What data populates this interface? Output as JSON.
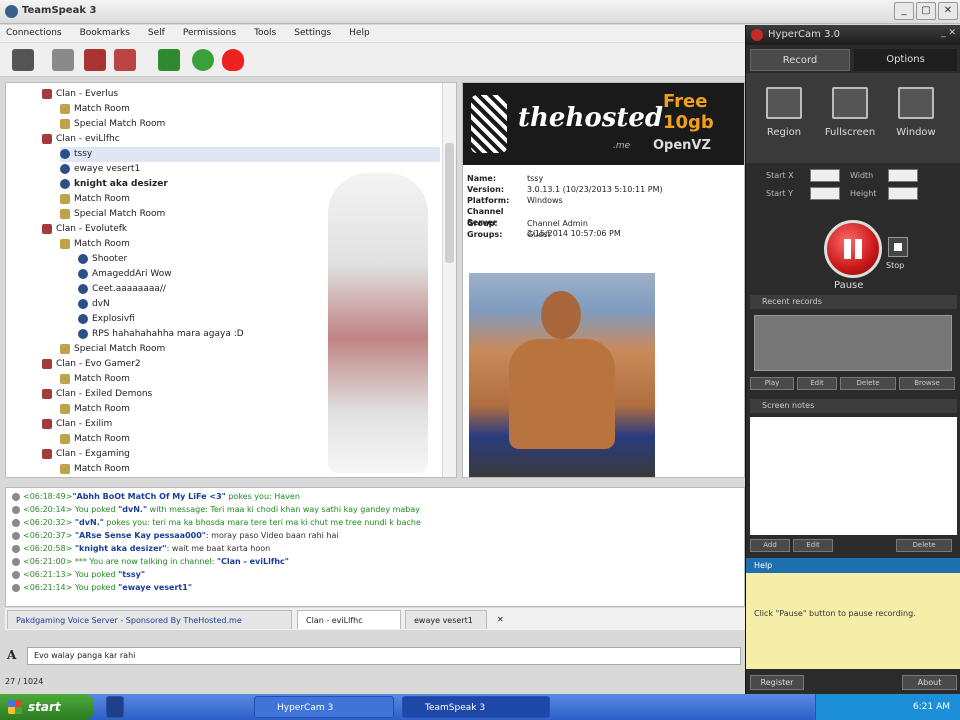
{
  "window": {
    "title": "TeamSpeak 3",
    "controls": [
      "_",
      "▢",
      "✕"
    ]
  },
  "menu": [
    "Connections",
    "Bookmarks",
    "Self",
    "Permissions",
    "Tools",
    "Settings",
    "Help"
  ],
  "tree": [
    {
      "label": "Clan - Everlus",
      "kind": "clan",
      "indent": 1
    },
    {
      "label": "Match Room",
      "kind": "chan",
      "indent": 2
    },
    {
      "label": "Special Match Room",
      "kind": "chan",
      "indent": 2
    },
    {
      "label": "Clan - eviLlfhc",
      "kind": "clan",
      "indent": 1
    },
    {
      "label": "tssy",
      "kind": "user",
      "indent": 2
    },
    {
      "label": "ewaye vesert1",
      "kind": "user",
      "indent": 2
    },
    {
      "label": "knight aka desizer",
      "kind": "user",
      "indent": 2,
      "bold": true
    },
    {
      "label": "Match Room",
      "kind": "chan",
      "indent": 2
    },
    {
      "label": "Special Match Room",
      "kind": "chan",
      "indent": 2
    },
    {
      "label": "Clan - Evolutefk",
      "kind": "clan",
      "indent": 1
    },
    {
      "label": "Match Room",
      "kind": "chan",
      "indent": 2
    },
    {
      "label": "Shooter",
      "kind": "user",
      "indent": 3
    },
    {
      "label": "AmageddAri Wow",
      "kind": "user",
      "indent": 3
    },
    {
      "label": "Ceet.aaaaaaaa//",
      "kind": "user",
      "indent": 3
    },
    {
      "label": "dvN",
      "kind": "user",
      "indent": 3
    },
    {
      "label": "Explosivfi",
      "kind": "user",
      "indent": 3
    },
    {
      "label": "RPS hahahahahha mara agaya :D",
      "kind": "user",
      "indent": 3
    },
    {
      "label": "Special Match Room",
      "kind": "chan",
      "indent": 2
    },
    {
      "label": "Clan - Evo Gamer2",
      "kind": "clan",
      "indent": 1
    },
    {
      "label": "Match Room",
      "kind": "chan",
      "indent": 2
    },
    {
      "label": "Clan - Exiled Demons",
      "kind": "clan",
      "indent": 1
    },
    {
      "label": "Match Room",
      "kind": "chan",
      "indent": 2
    },
    {
      "label": "Clan - Exilim",
      "kind": "clan",
      "indent": 1
    },
    {
      "label": "Match Room",
      "kind": "chan",
      "indent": 2
    },
    {
      "label": "Clan - Exgaming",
      "kind": "clan",
      "indent": 1
    },
    {
      "label": "Match Room",
      "kind": "chan",
      "indent": 2
    }
  ],
  "info": {
    "banner_brand": "thehosted",
    "banner_tld": ".me",
    "banner_promo": "Free 10gb",
    "banner_sub": "OpenVZ",
    "rows": [
      {
        "k": "Name:",
        "v": "tssy"
      },
      {
        "k": "Version:",
        "v": "3.0.13.1 (10/23/2013 5:10:11 PM)"
      },
      {
        "k": "Platform:",
        "v": "Windows"
      },
      {
        "k": "Channel Group:",
        "v": "Channel Admin"
      },
      {
        "k": "Server Groups:",
        "v": "Guest"
      },
      {
        "k": "",
        "v": "2/15/2014 10:57:06 PM"
      }
    ]
  },
  "chat": [
    {
      "ts": "<06:18:49>",
      "pre": "",
      "nick": "\"Abhh BoOt MatCh Of My LiFe <3\"",
      "post": " pokes you: Haven"
    },
    {
      "ts": "<06:20:14>",
      "pre": " You poked ",
      "nick": "\"dvN.\"",
      "post": " with message: Teri maa ki chodi khan way sathi kay gandey mabay"
    },
    {
      "ts": "<06:20:32>",
      "pre": " ",
      "nick": "\"dvN.\"",
      "post": " pokes you: teri ma ka bhosda mara tere teri ma ki chut me tree nundi k bache"
    },
    {
      "ts": "<06:20:37>",
      "pre": " ",
      "nick": "\"ARse Sense Kay pessaa000\"",
      "post": ": moray paso Video baan rahi hai",
      "dark": true
    },
    {
      "ts": "<06:20:58>",
      "pre": " ",
      "nick": "\"knight aka desizer\"",
      "post": ": wait me baat karta hoon",
      "dark": true
    },
    {
      "ts": "<06:21:00>",
      "pre": " *** You are now talking in channel: ",
      "nick": "\"Clan - eviLlfhc\"",
      "post": ""
    },
    {
      "ts": "<06:21:13>",
      "pre": " You poked ",
      "nick": "\"tssy\"",
      "post": ""
    },
    {
      "ts": "<06:21:14>",
      "pre": " You poked ",
      "nick": "\"ewaye vesert1\"",
      "post": ""
    }
  ],
  "tabs": [
    "Pakdgaming Voice Server - Sponsored By TheHosted.me",
    "Clan - eviLlfhc",
    "ewaye vesert1",
    "✕"
  ],
  "input": {
    "value": "Evo walay panga kar rahi"
  },
  "status": "27 / 1024",
  "taskbar": {
    "start": "start",
    "items": [
      "HyperCam 3",
      "TeamSpeak 3"
    ],
    "clock": "6:21 AM"
  },
  "hypercam": {
    "title": "HyperCam 3.0",
    "controls": "_  ✕",
    "tab_record": "Record",
    "tab_options": "Options",
    "modes": [
      "Region",
      "Fullscreen",
      "Window"
    ],
    "start_x": "Start X",
    "start_y": "Start Y",
    "width": "Width",
    "height": "Height",
    "pause_label": "Pause",
    "stop_label": "Stop",
    "recent_records": "Recent records",
    "record_buttons": [
      "Play",
      "Edit",
      "Delete",
      "Browse"
    ],
    "screen_notes": "Screen notes",
    "notes_buttons": [
      "Add",
      "Edit",
      "Delete"
    ],
    "help_title": "Help",
    "help_text": "Click \"Pause\" button to pause recording.",
    "register": "Register",
    "about": "About"
  },
  "colors": {
    "accent": "#1e6fb0",
    "record": "#c81818",
    "help_bg": "#f5eda8"
  }
}
